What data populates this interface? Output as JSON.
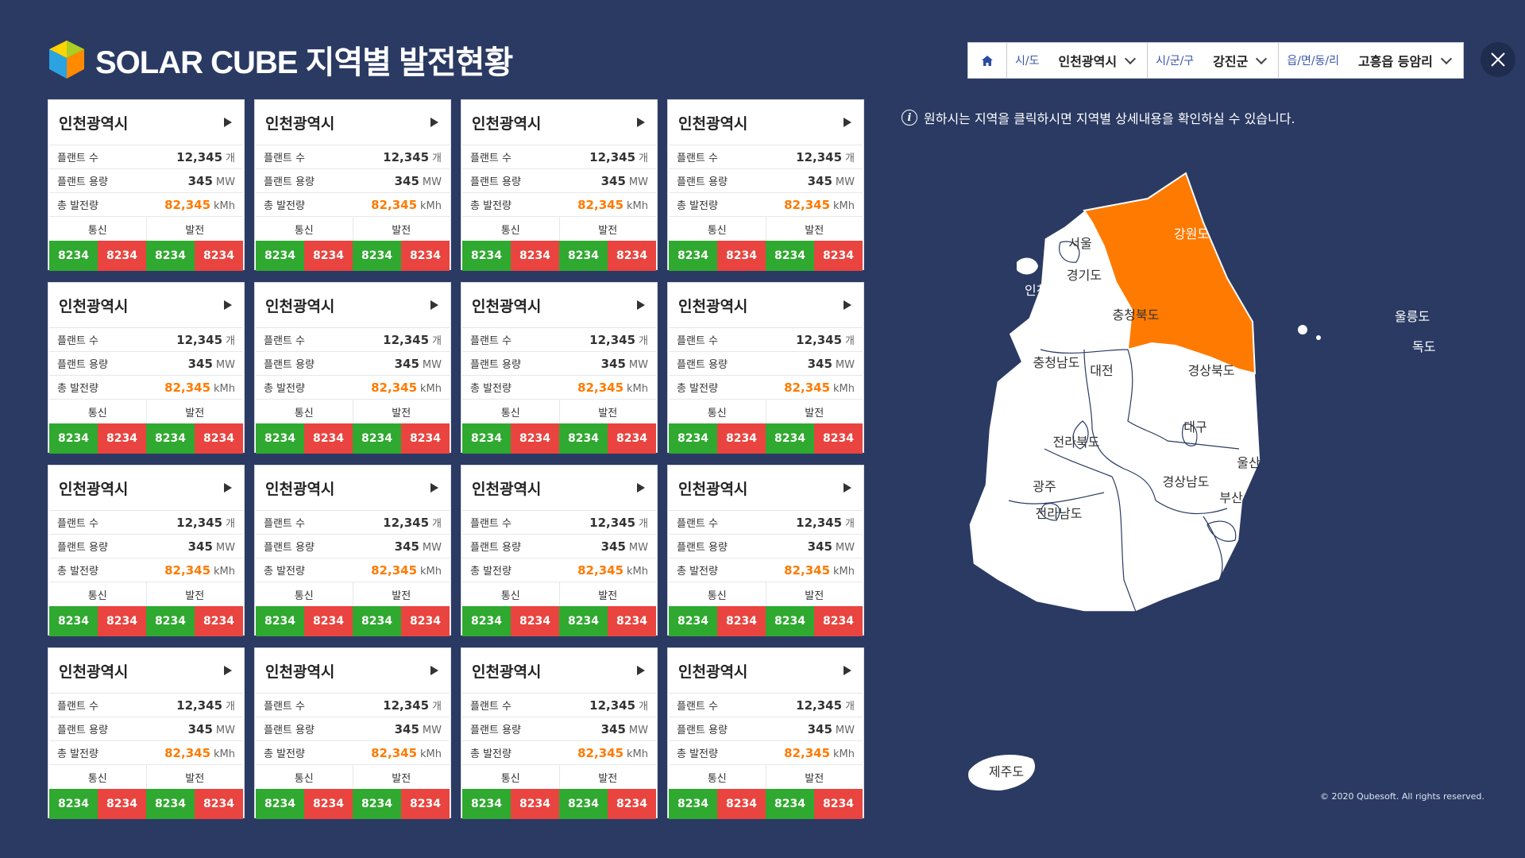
{
  "app_title": "SOLAR CUBE 지역별 발전현황",
  "filter": {
    "segments": [
      {
        "label": "시/도",
        "value": "인천광역시"
      },
      {
        "label": "시/군/구",
        "value": "강진군"
      },
      {
        "label": "읍/면/동/리",
        "value": "고흥읍 등암리"
      }
    ]
  },
  "card_labels": {
    "plants": "플랜트 수",
    "capacity": "플랜트 용량",
    "total": "총 발전량",
    "comm": "통신",
    "gen": "발전"
  },
  "cards": [
    {
      "title": "인천광역시",
      "plants": "12,345",
      "plants_unit": "개",
      "capacity": "345",
      "capacity_unit": "MW",
      "total": "82,345",
      "total_unit": "kMh",
      "stats": [
        "8234",
        "8234",
        "8234",
        "8234"
      ]
    },
    {
      "title": "인천광역시",
      "plants": "12,345",
      "plants_unit": "개",
      "capacity": "345",
      "capacity_unit": "MW",
      "total": "82,345",
      "total_unit": "kMh",
      "stats": [
        "8234",
        "8234",
        "8234",
        "8234"
      ]
    },
    {
      "title": "인천광역시",
      "plants": "12,345",
      "plants_unit": "개",
      "capacity": "345",
      "capacity_unit": "MW",
      "total": "82,345",
      "total_unit": "kMh",
      "stats": [
        "8234",
        "8234",
        "8234",
        "8234"
      ]
    },
    {
      "title": "인천광역시",
      "plants": "12,345",
      "plants_unit": "개",
      "capacity": "345",
      "capacity_unit": "MW",
      "total": "82,345",
      "total_unit": "kMh",
      "stats": [
        "8234",
        "8234",
        "8234",
        "8234"
      ]
    },
    {
      "title": "인천광역시",
      "plants": "12,345",
      "plants_unit": "개",
      "capacity": "345",
      "capacity_unit": "MW",
      "total": "82,345",
      "total_unit": "kMh",
      "stats": [
        "8234",
        "8234",
        "8234",
        "8234"
      ]
    },
    {
      "title": "인천광역시",
      "plants": "12,345",
      "plants_unit": "개",
      "capacity": "345",
      "capacity_unit": "MW",
      "total": "82,345",
      "total_unit": "kMh",
      "stats": [
        "8234",
        "8234",
        "8234",
        "8234"
      ]
    },
    {
      "title": "인천광역시",
      "plants": "12,345",
      "plants_unit": "개",
      "capacity": "345",
      "capacity_unit": "MW",
      "total": "82,345",
      "total_unit": "kMh",
      "stats": [
        "8234",
        "8234",
        "8234",
        "8234"
      ]
    },
    {
      "title": "인천광역시",
      "plants": "12,345",
      "plants_unit": "개",
      "capacity": "345",
      "capacity_unit": "MW",
      "total": "82,345",
      "total_unit": "kMh",
      "stats": [
        "8234",
        "8234",
        "8234",
        "8234"
      ]
    },
    {
      "title": "인천광역시",
      "plants": "12,345",
      "plants_unit": "개",
      "capacity": "345",
      "capacity_unit": "MW",
      "total": "82,345",
      "total_unit": "kMh",
      "stats": [
        "8234",
        "8234",
        "8234",
        "8234"
      ]
    },
    {
      "title": "인천광역시",
      "plants": "12,345",
      "plants_unit": "개",
      "capacity": "345",
      "capacity_unit": "MW",
      "total": "82,345",
      "total_unit": "kMh",
      "stats": [
        "8234",
        "8234",
        "8234",
        "8234"
      ]
    },
    {
      "title": "인천광역시",
      "plants": "12,345",
      "plants_unit": "개",
      "capacity": "345",
      "capacity_unit": "MW",
      "total": "82,345",
      "total_unit": "kMh",
      "stats": [
        "8234",
        "8234",
        "8234",
        "8234"
      ]
    },
    {
      "title": "인천광역시",
      "plants": "12,345",
      "plants_unit": "개",
      "capacity": "345",
      "capacity_unit": "MW",
      "total": "82,345",
      "total_unit": "kMh",
      "stats": [
        "8234",
        "8234",
        "8234",
        "8234"
      ]
    },
    {
      "title": "인천광역시",
      "plants": "12,345",
      "plants_unit": "개",
      "capacity": "345",
      "capacity_unit": "MW",
      "total": "82,345",
      "total_unit": "kMh",
      "stats": [
        "8234",
        "8234",
        "8234",
        "8234"
      ]
    },
    {
      "title": "인천광역시",
      "plants": "12,345",
      "plants_unit": "개",
      "capacity": "345",
      "capacity_unit": "MW",
      "total": "82,345",
      "total_unit": "kMh",
      "stats": [
        "8234",
        "8234",
        "8234",
        "8234"
      ]
    },
    {
      "title": "인천광역시",
      "plants": "12,345",
      "plants_unit": "개",
      "capacity": "345",
      "capacity_unit": "MW",
      "total": "82,345",
      "total_unit": "kMh",
      "stats": [
        "8234",
        "8234",
        "8234",
        "8234"
      ]
    },
    {
      "title": "인천광역시",
      "plants": "12,345",
      "plants_unit": "개",
      "capacity": "345",
      "capacity_unit": "MW",
      "total": "82,345",
      "total_unit": "kMh",
      "stats": [
        "8234",
        "8234",
        "8234",
        "8234"
      ]
    }
  ],
  "info_text": "원하시는 지역을 클릭하시면 지역별 상세내용을 확인하실 수 있습니다.",
  "map": {
    "selected_region": "강원도",
    "selected_color": "#ff7a00",
    "regions": [
      "인천",
      "서울",
      "경기도",
      "강원도",
      "충청북도",
      "충청남도",
      "대전",
      "경상북도",
      "전라북도",
      "대구",
      "울산",
      "경상남도",
      "광주",
      "부산",
      "전라남도",
      "제주도",
      "울릉도",
      "독도"
    ]
  },
  "colors": {
    "background": "#2a3a63",
    "good": "#2fa92f",
    "bad": "#e9443f",
    "accent": "#ff7a00"
  },
  "copyright": "© 2020 Qubesoft. All rights reserved."
}
